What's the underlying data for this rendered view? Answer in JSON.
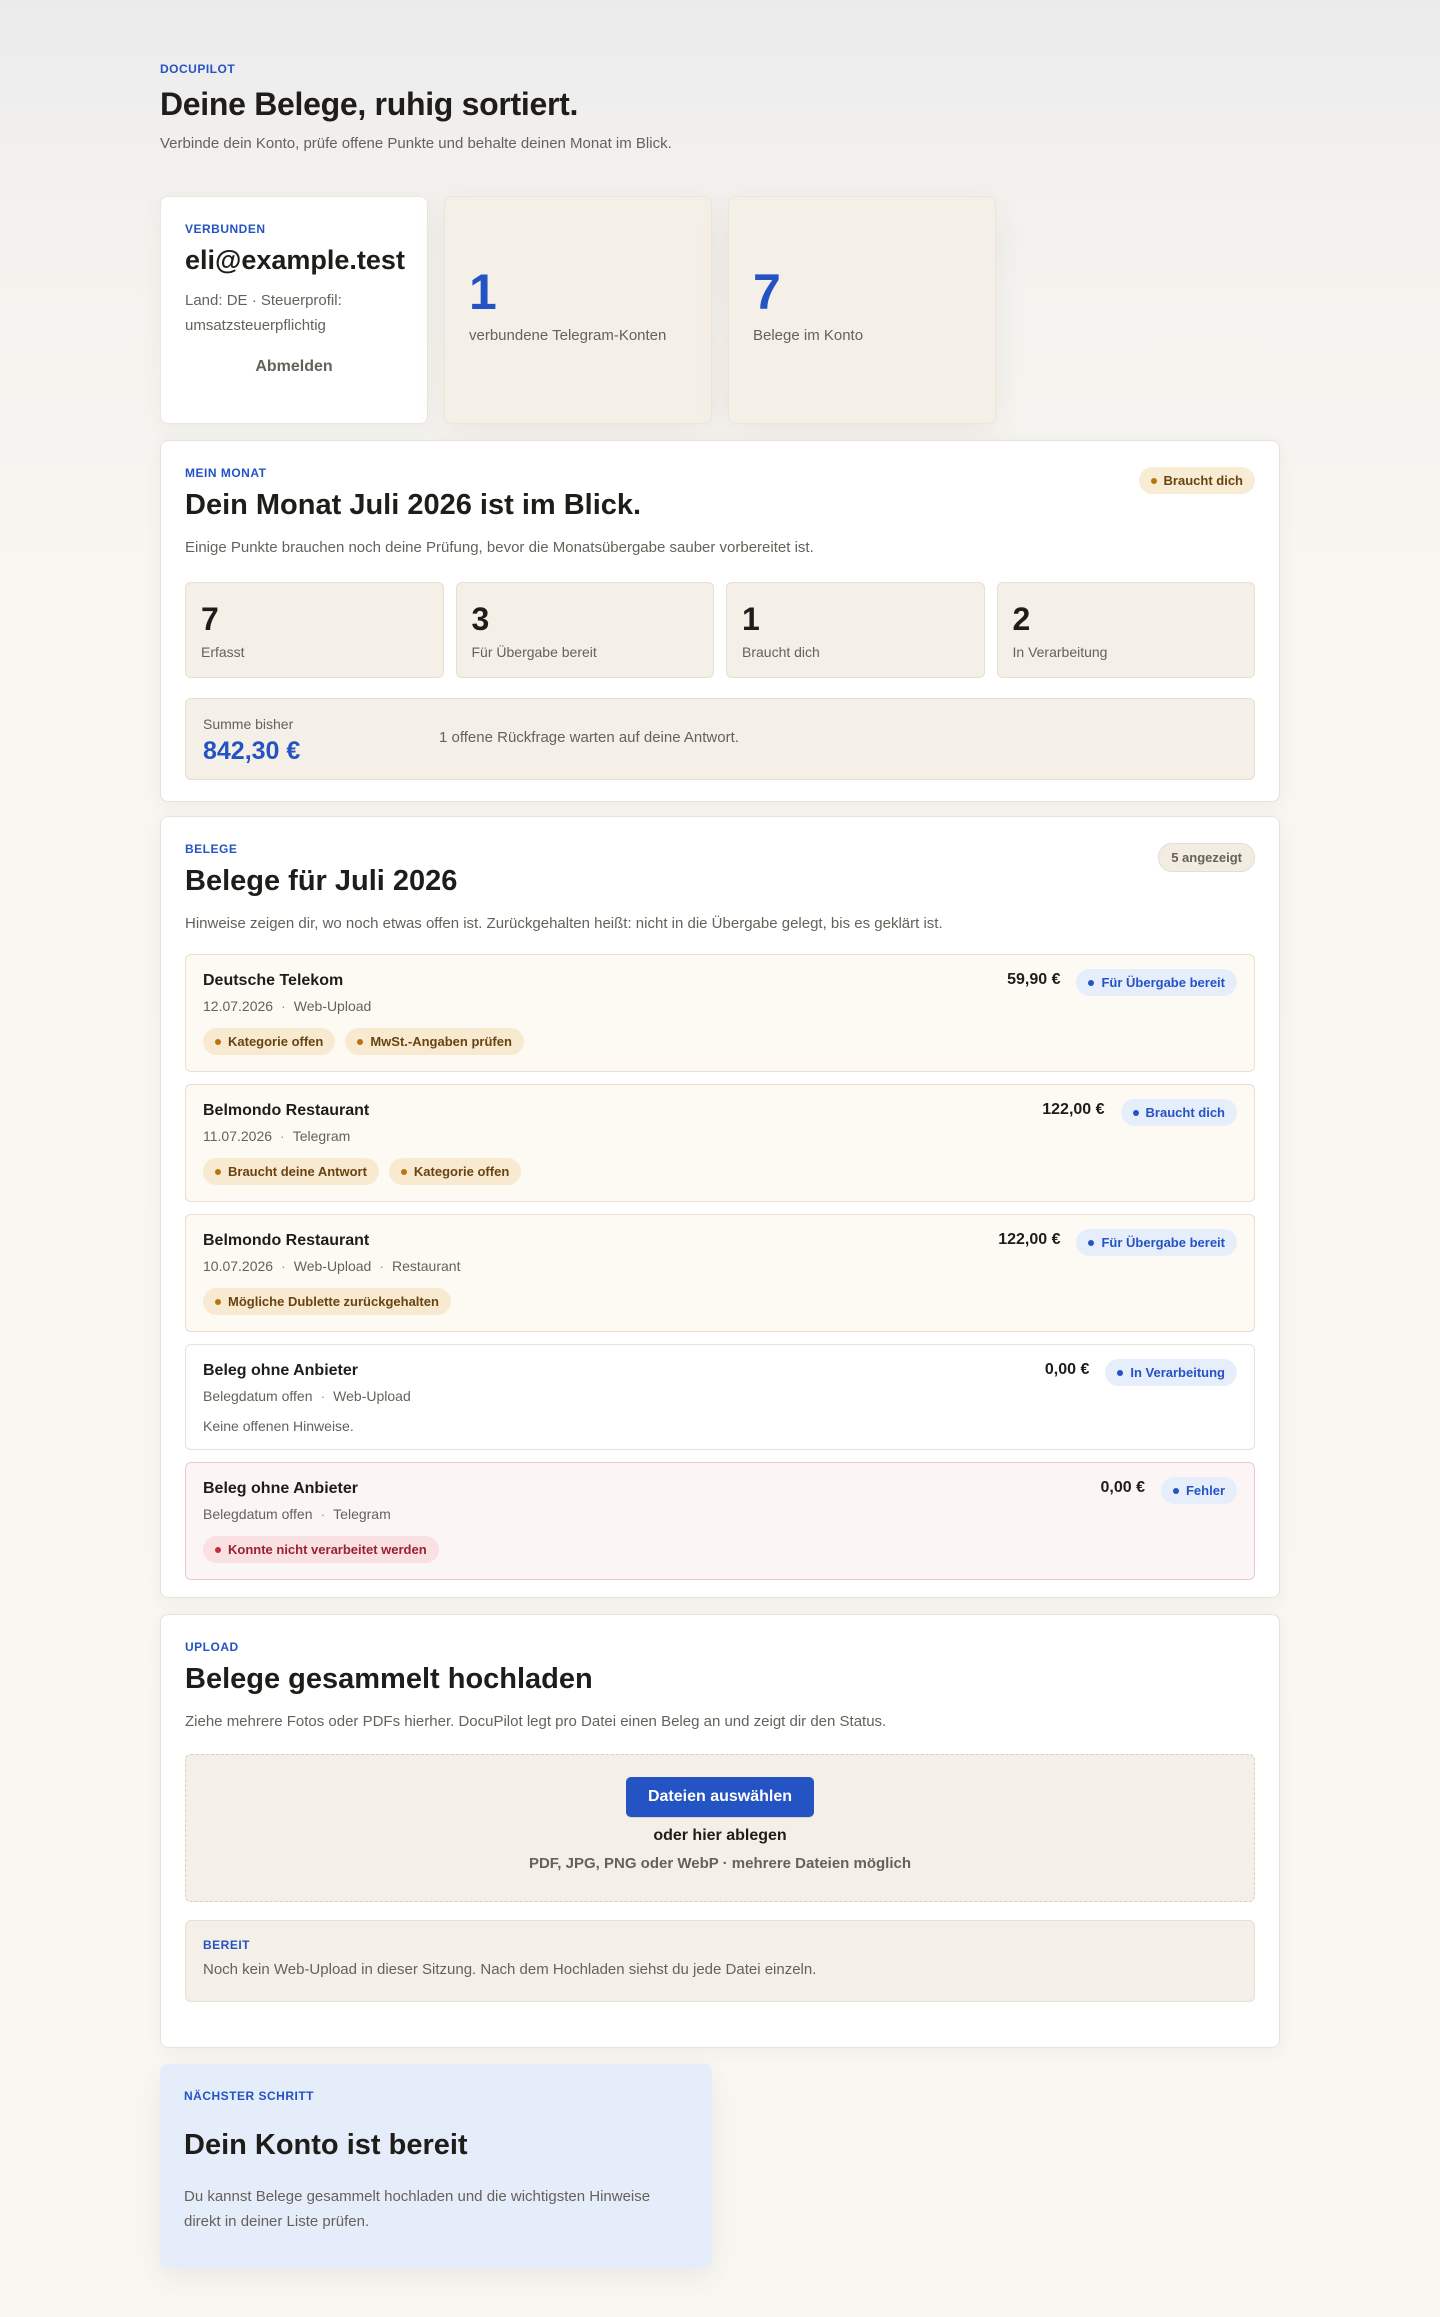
{
  "header": {
    "brand": "DOCUPILOT",
    "title": "Deine Belege, ruhig sortiert.",
    "subtitle": "Verbinde dein Konto, prüfe offene Punkte und behalte deinen Monat im Blick."
  },
  "account": {
    "eyebrow": "VERBUNDEN",
    "email": "eli@example.test",
    "meta": "Land: DE · Steuerprofil: umsatzsteuerpflichtig",
    "logout_label": "Abmelden"
  },
  "stats": [
    {
      "value": "1",
      "label": "verbundene Telegram-Konten"
    },
    {
      "value": "7",
      "label": "Belege im Konto"
    }
  ],
  "month": {
    "eyebrow": "MEIN MONAT",
    "badge": "Braucht dich",
    "title": "Dein Monat Juli 2026 ist im Blick.",
    "subtitle": "Einige Punkte brauchen noch deine Prüfung, bevor die Monatsübergabe sauber vorbereitet ist.",
    "metrics": [
      {
        "value": "7",
        "label": "Erfasst"
      },
      {
        "value": "3",
        "label": "Für Übergabe bereit"
      },
      {
        "value": "1",
        "label": "Braucht dich"
      },
      {
        "value": "2",
        "label": "In Verarbeitung"
      }
    ],
    "sum_label": "Summe bisher",
    "sum_value": "842,30 €",
    "open_message": "1 offene Rückfrage warten auf deine Antwort."
  },
  "receipts": {
    "eyebrow": "BELEGE",
    "count_badge": "5 angezeigt",
    "title": "Belege für Juli 2026",
    "subtitle": "Hinweise zeigen dir, wo noch etwas offen ist. Zurückgehalten heißt: nicht in die Übergabe gelegt, bis es geklärt ist.",
    "items": [
      {
        "name": "Deutsche Telekom",
        "date": "12.07.2026",
        "source": "Web-Upload",
        "category": "",
        "amount": "59,90 €",
        "status": "Für Übergabe bereit",
        "tags": [
          "Kategorie offen",
          "MwSt.-Angaben prüfen"
        ],
        "note": ""
      },
      {
        "name": "Belmondo Restaurant",
        "date": "11.07.2026",
        "source": "Telegram",
        "category": "",
        "amount": "122,00 €",
        "status": "Braucht dich",
        "tags": [
          "Braucht deine Antwort",
          "Kategorie offen"
        ],
        "note": ""
      },
      {
        "name": "Belmondo Restaurant",
        "date": "10.07.2026",
        "source": "Web-Upload",
        "category": "Restaurant",
        "amount": "122,00 €",
        "status": "Für Übergabe bereit",
        "tags": [
          "Mögliche Dublette zurückgehalten"
        ],
        "note": ""
      },
      {
        "name": "Beleg ohne Anbieter",
        "date": "Belegdatum offen",
        "source": "Web-Upload",
        "category": "",
        "amount": "0,00 €",
        "status": "In Verarbeitung",
        "tags": [],
        "note": "Keine offenen Hinweise."
      },
      {
        "name": "Beleg ohne Anbieter",
        "date": "Belegdatum offen",
        "source": "Telegram",
        "category": "",
        "amount": "0,00 €",
        "status": "Fehler",
        "tags": [
          "Konnte nicht verarbeitet werden"
        ],
        "note": ""
      }
    ]
  },
  "upload": {
    "eyebrow": "UPLOAD",
    "title": "Belege gesammelt hochladen",
    "subtitle": "Ziehe mehrere Fotos oder PDFs hierher. DocuPilot legt pro Datei einen Beleg an und zeigt dir den Status.",
    "button_label": "Dateien auswählen",
    "drop_label": "oder hier ablegen",
    "formats": "PDF, JPG, PNG oder WebP · mehrere Dateien möglich",
    "ready_eyebrow": "BEREIT",
    "ready_text": "Noch kein Web-Upload in dieser Sitzung. Nach dem Hochladen siehst du jede Datei einzeln."
  },
  "next_step": {
    "eyebrow": "NÄCHSTER SCHRITT",
    "title": "Dein Konto ist bereit",
    "text": "Du kannst Belege gesammelt hochladen und die wichtigsten Hinweise direkt in deiner Liste prüfen."
  }
}
